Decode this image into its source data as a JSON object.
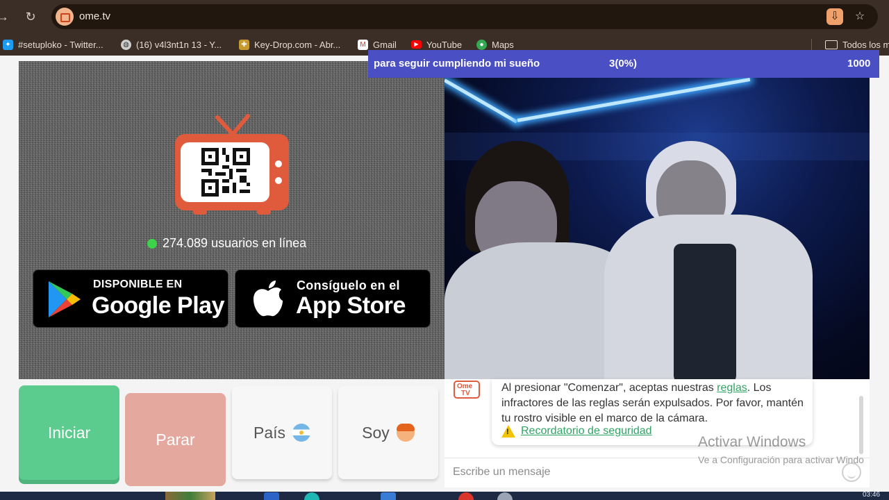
{
  "browser": {
    "url": "ome.tv",
    "bookmarks": [
      {
        "label": "#setuploko - Twitter..."
      },
      {
        "label": "(16) v4l3nt1n 13 - Y..."
      },
      {
        "label": "Key-Drop.com - Abr..."
      },
      {
        "label": "Gmail"
      },
      {
        "label": "YouTube"
      },
      {
        "label": "Maps"
      },
      {
        "label": "Todos los m"
      }
    ]
  },
  "promo": {
    "online_count": "274.089 usuarios en línea",
    "google_play": {
      "small": "DISPONIBLE EN",
      "big": "Google Play"
    },
    "app_store": {
      "small": "Consíguelo en el",
      "big": "App Store"
    }
  },
  "banner": {
    "text": "para seguir cumpliendo mi sueño",
    "progress": "3(0%)",
    "goal": "1000"
  },
  "controls": {
    "start": "Iniciar",
    "stop": "Parar",
    "country": "País",
    "gender": "Soy"
  },
  "chat": {
    "logo_top": "Ome",
    "logo_bottom": "TV",
    "msg_before": "Al presionar \"Comenzar\", aceptas nuestras ",
    "rules_link": "reglas",
    "msg_after": ". Los infractores de las reglas serán expulsados. Por favor, mantén tu rostro visible en el marco de la cámara.",
    "safety_link": "Recordatorio de seguridad",
    "input_placeholder": "Escribe un mensaje"
  },
  "watermark": {
    "title": "Activar Windows",
    "subtitle": "Ve a Configuración para activar Windo"
  },
  "taskbar": {
    "clock": "03:46"
  },
  "colors": {
    "chrome_bg": "#3b2e26",
    "brand_red": "#e05a3c",
    "start_green": "#5ccb8e",
    "stop_pink": "#e4a89e",
    "banner_blue": "#4a4fc4",
    "link_green": "#2fa463"
  }
}
